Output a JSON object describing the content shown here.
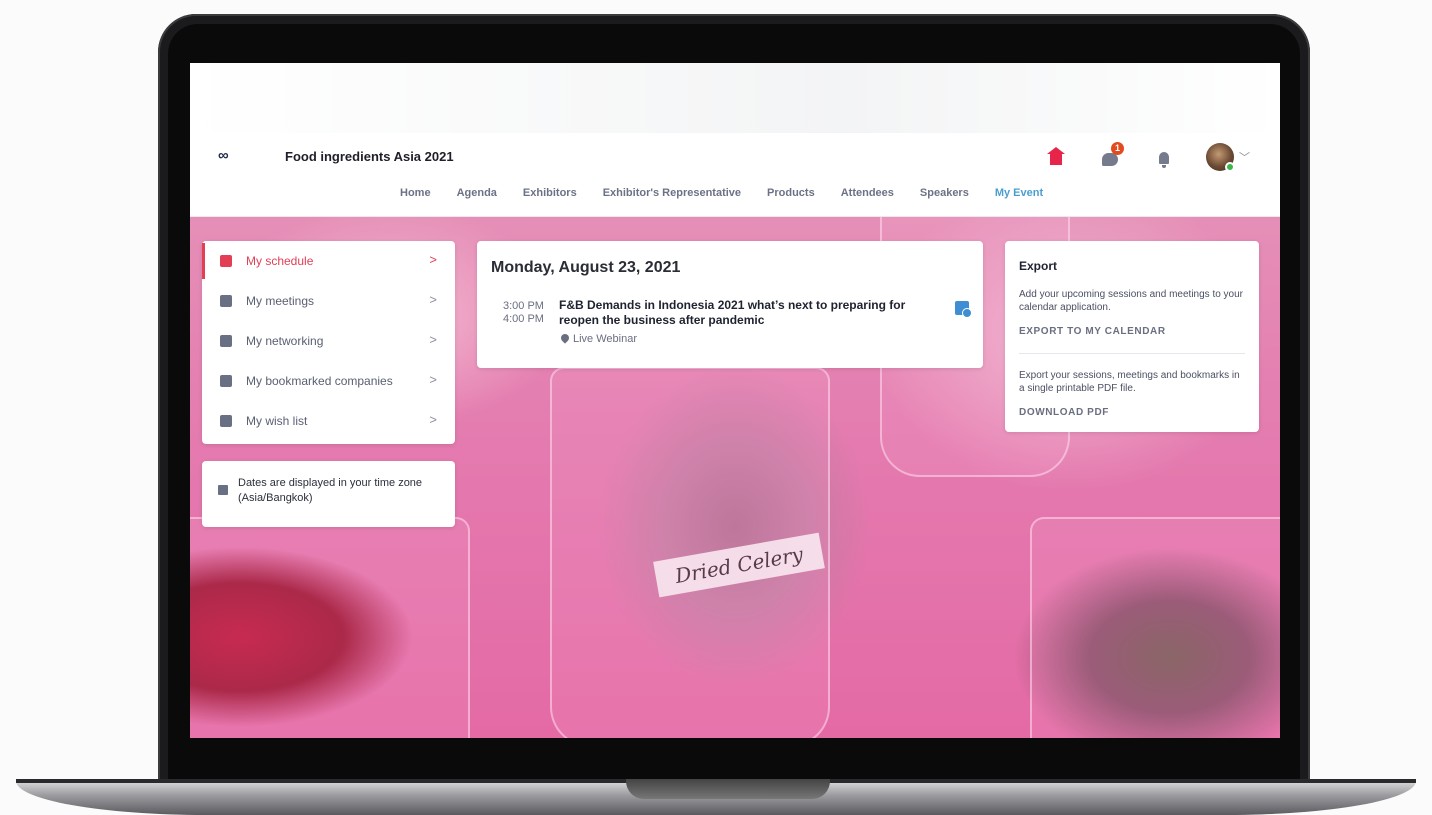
{
  "app": {
    "title": "Food ingredients Asia 2021"
  },
  "header": {
    "icons": [
      "home-icon",
      "chat-icon",
      "bell-icon"
    ],
    "chat_badge": "1"
  },
  "nav": [
    {
      "label": "Home"
    },
    {
      "label": "Agenda"
    },
    {
      "label": "Exhibitors"
    },
    {
      "label": "Exhibitor's Representative"
    },
    {
      "label": "Products"
    },
    {
      "label": "Attendees"
    },
    {
      "label": "Speakers"
    },
    {
      "label": "My Event",
      "active": true
    }
  ],
  "sidebar": {
    "items": [
      {
        "label": "My schedule",
        "icon": "calendar-icon",
        "active": true
      },
      {
        "label": "My meetings",
        "icon": "meetings-icon"
      },
      {
        "label": "My networking",
        "icon": "networking-icon"
      },
      {
        "label": "My bookmarked companies",
        "icon": "bookmark-icon"
      },
      {
        "label": "My wish list",
        "icon": "wishlist-icon"
      }
    ],
    "timezone_note": "Dates are displayed in your time zone (Asia/Bangkok)"
  },
  "schedule": {
    "date": "Monday, August 23, 2021",
    "sessions": [
      {
        "start": "3:00 PM",
        "end": "4:00 PM",
        "title": "F&B Demands in Indonesia 2021 what’s next to preparing for reopen the business after pandemic",
        "location": "Live Webinar"
      }
    ]
  },
  "export": {
    "title": "Export",
    "calendar_desc": "Add your upcoming sessions and meetings to your calendar application.",
    "calendar_link": "EXPORT TO MY CALENDAR",
    "pdf_desc": "Export your sessions, meetings and bookmarks in a single printable PDF file.",
    "pdf_link": "DOWNLOAD PDF"
  },
  "background": {
    "jar_label": "Dried Celery"
  },
  "colors": {
    "accent": "#e23f55",
    "nav_active": "#4a9fd0",
    "home": "#e7254b"
  }
}
